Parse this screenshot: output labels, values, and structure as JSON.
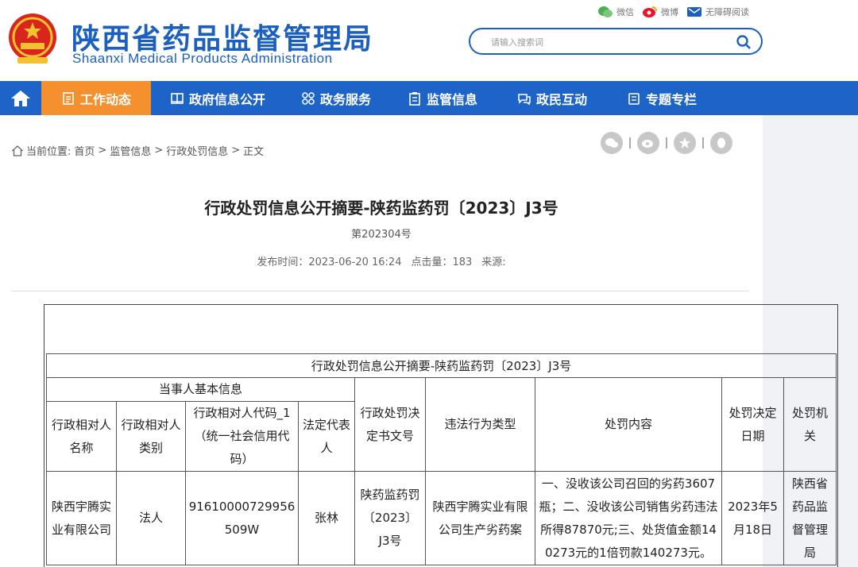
{
  "header": {
    "title_cn": "陕西省药品监督管理局",
    "title_en": "Shaanxi Medical Products Administration",
    "top_links": [
      {
        "label": "微信",
        "icon": "wechat-icon"
      },
      {
        "label": "微博",
        "icon": "weibo-icon"
      },
      {
        "label": "无障碍阅读",
        "icon": "accessibility-icon"
      }
    ],
    "search_placeholder": "请输入搜索词"
  },
  "nav": {
    "items": [
      {
        "label": "工作动态",
        "icon": "document-icon",
        "active": true
      },
      {
        "label": "政府信息公开",
        "icon": "book-icon",
        "active": false
      },
      {
        "label": "政务服务",
        "icon": "grid-icon",
        "active": false
      },
      {
        "label": "监管信息",
        "icon": "clipboard-icon",
        "active": false
      },
      {
        "label": "政民互动",
        "icon": "chat-icon",
        "active": false
      },
      {
        "label": "专题专栏",
        "icon": "folder-icon",
        "active": false
      }
    ]
  },
  "breadcrumb": {
    "prefix": "当前位置:",
    "items": [
      "首页",
      "监管信息",
      "行政处罚信息",
      "正文"
    ]
  },
  "article": {
    "title": "行政处罚信息公开摘要-陕药监药罚〔2023〕J3号",
    "subtitle": "第202304号",
    "publish_label": "发布时间：2023-06-20 16:24",
    "clicks_label": "点击量：183",
    "source_label": "来源:"
  },
  "table": {
    "title": "行政处罚信息公开摘要-陕药监药罚〔2023〕J3号",
    "group_header": "当事人基本信息",
    "headers": [
      "行政相对人名称",
      "行政相对人类别",
      "行政相对人代码_1（统一社会信用代码）",
      "法定代表人",
      "行政处罚决定书文号",
      "违法行为类型",
      "处罚内容",
      "处罚决定日期",
      "处罚机关"
    ],
    "row": [
      "陕西宇腾实业有限公司",
      "法人",
      "91610000729956509W",
      "张林",
      "陕药监药罚〔2023〕J3号",
      "陕西宇腾实业有限公司生产劣药案",
      "一、没收该公司召回的劣药3607瓶；二、没收该公司销售劣药违法所得87870元;三、处货值金额140273元的1倍罚款140273元。",
      "2023年5月18日",
      "陕西省药品监督管理局"
    ]
  }
}
